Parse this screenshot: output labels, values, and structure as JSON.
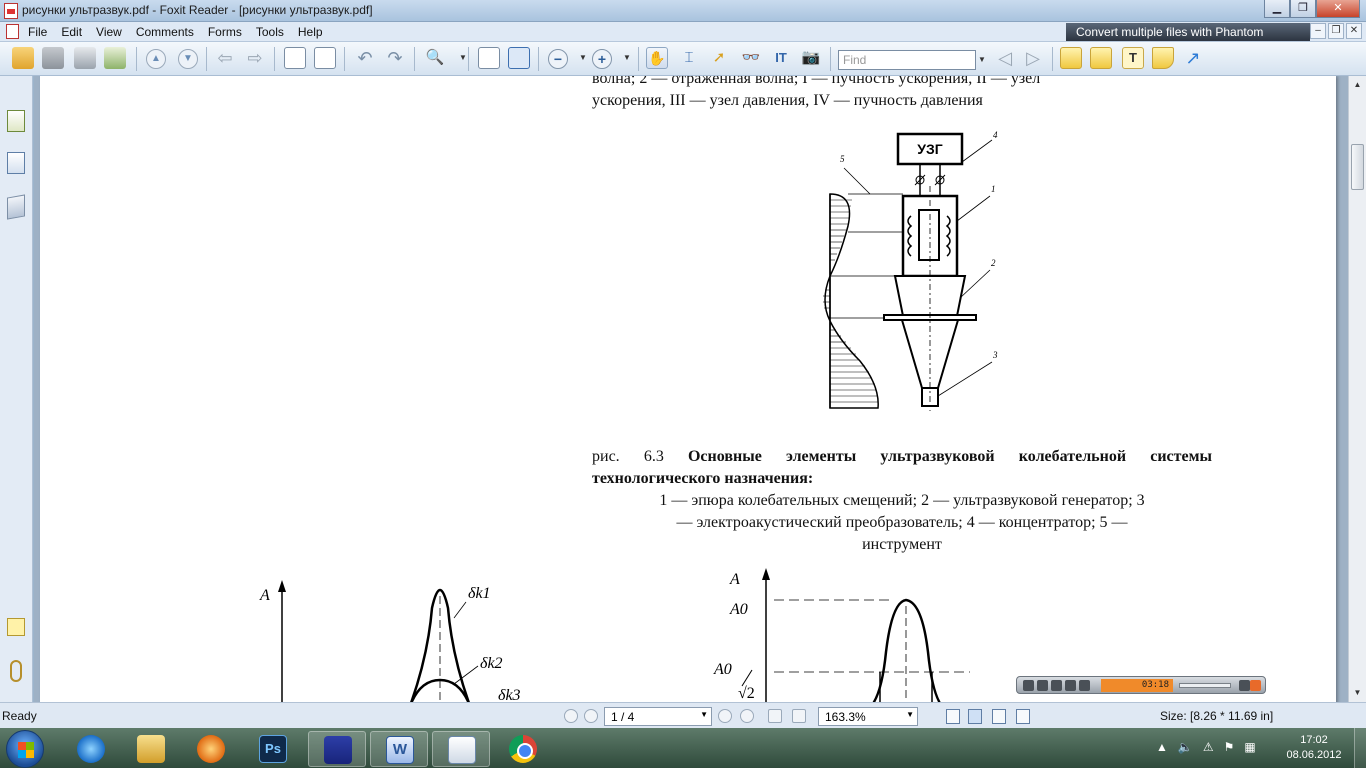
{
  "window": {
    "title": "рисунки ультразвук.pdf - Foxit Reader - [рисунки ультразвук.pdf]",
    "minimize": "▁",
    "maximize": "❐",
    "close": "✕"
  },
  "menu": {
    "items": [
      "File",
      "Edit",
      "View",
      "Comments",
      "Forms",
      "Tools",
      "Help"
    ],
    "ad_banner": "Convert multiple files with Phantom"
  },
  "toolbar": {
    "find_placeholder": "Find"
  },
  "document": {
    "top_line1": "волна; 2 — отраженная волна; I — пучность ускорения, II — узел",
    "top_line2": "ускорения, III — узел давления, IV — пучность давления",
    "diagram": {
      "generator_label": "УЗГ",
      "callouts": [
        "1",
        "2",
        "3",
        "4",
        "5"
      ]
    },
    "caption": {
      "fig_prefix": "рис. 6.3",
      "title_part1": "Основные элементы ультразвуковой колебательной системы",
      "title_part2": "технологического назначения:",
      "legend_line1": "1 — эпюра колебательных смещений; 2 — ультразвуковой генератор; 3",
      "legend_line2": "— электроакустический преобразователь; 4 — концентратор; 5 —",
      "legend_line3": "инструмент"
    },
    "graph_left": {
      "axis_label": "A",
      "labels": [
        "δk1",
        "δk2",
        "δk3"
      ]
    },
    "graph_right": {
      "axis_label": "A",
      "peak_label": "A0",
      "half_label_num": "A0",
      "half_label_den": "√2"
    }
  },
  "media_widget": {
    "time": "03:18"
  },
  "status": {
    "ready": "Ready",
    "page": "1 / 4",
    "zoom": "163.3%",
    "size": "Size: [8.26 * 11.69 in]"
  },
  "taskbar": {
    "ps_label": "Ps",
    "word_label": "W",
    "clock_time": "17:02",
    "clock_date": "08.06.2012"
  }
}
